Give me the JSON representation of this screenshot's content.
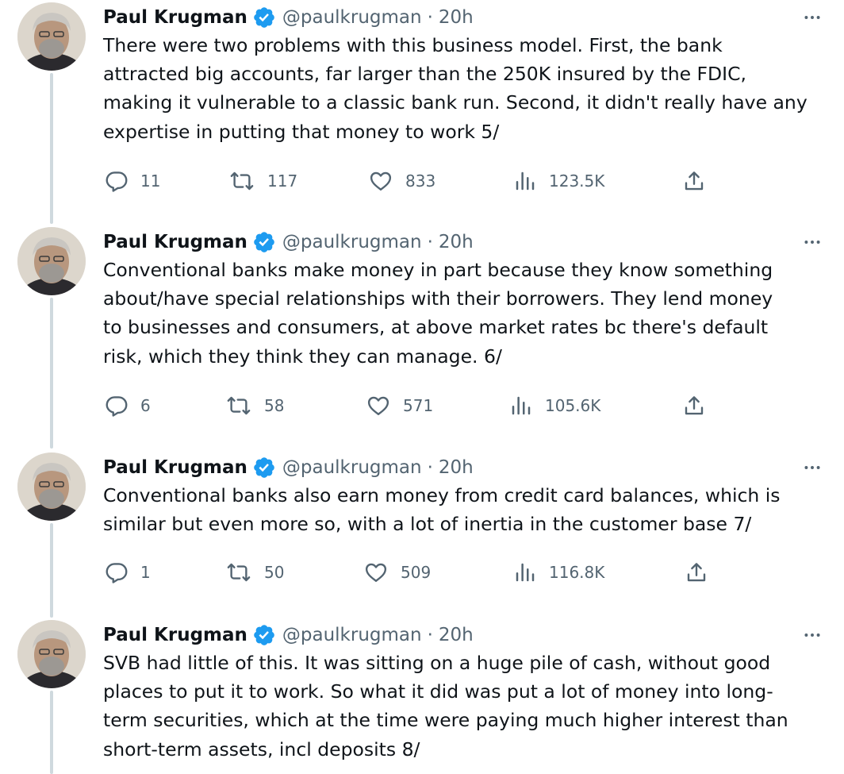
{
  "tweets": [
    {
      "name": "Paul Krugman",
      "handle": "@paulkrugman",
      "separator": "·",
      "time": "20h",
      "text": "There were two problems with this business model. First, the bank\nattracted big accounts, far larger than the 250K insured by the FDIC,\nmaking it vulnerable to a classic bank run. Second, it didn't really have any\nexpertise in putting that money to work 5/",
      "replies": "11",
      "retweets": "117",
      "likes": "833",
      "views": "123.5K"
    },
    {
      "name": "Paul Krugman",
      "handle": "@paulkrugman",
      "separator": "·",
      "time": "20h",
      "text": "Conventional banks make money in part because they know something\nabout/have special relationships with their borrowers. They lend money\nto businesses and consumers, at above market rates bc there's default\nrisk, which they think they can manage. 6/",
      "replies": "6",
      "retweets": "58",
      "likes": "571",
      "views": "105.6K"
    },
    {
      "name": "Paul Krugman",
      "handle": "@paulkrugman",
      "separator": "·",
      "time": "20h",
      "text": "Conventional banks also earn money from credit card balances, which is\nsimilar but even more so, with a lot of inertia in the customer base 7/",
      "replies": "1",
      "retweets": "50",
      "likes": "509",
      "views": "116.8K"
    },
    {
      "name": "Paul Krugman",
      "handle": "@paulkrugman",
      "separator": "·",
      "time": "20h",
      "text": "SVB had little of this. It was sitting on a huge pile of cash, without good\nplaces to put it to work. So what it did was put a lot of money into long-\nterm securities, which at the time were paying much higher interest than\nshort-term assets, incl deposits 8/"
    }
  ],
  "icons": {
    "verified": "verified-badge-icon",
    "more": "more-icon",
    "reply": "reply-icon",
    "retweet": "retweet-icon",
    "like": "like-icon",
    "views": "views-icon",
    "share": "share-icon"
  },
  "colors": {
    "verified": "#1d9bf0",
    "muted": "#536471",
    "text": "#0f1419",
    "thread_line": "#cfd9de"
  }
}
